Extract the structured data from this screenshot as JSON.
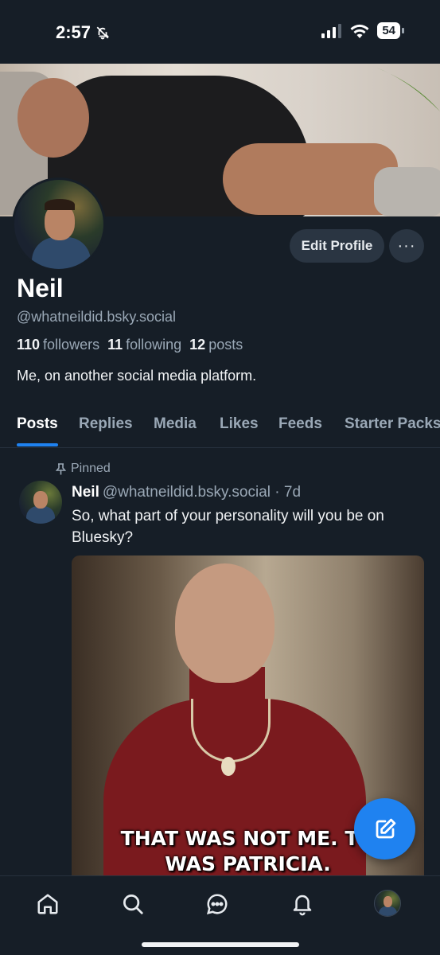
{
  "status_bar": {
    "time": "2:57",
    "battery": "54"
  },
  "profile": {
    "name": "Neil",
    "handle": "@whatneildid.bsky.social",
    "followers_count": "110",
    "followers_label": "followers",
    "following_count": "11",
    "following_label": "following",
    "posts_count": "12",
    "posts_label": "posts",
    "bio": "Me, on another social media platform.",
    "edit_profile_label": "Edit Profile",
    "more_label": "···"
  },
  "tabs": [
    {
      "label": "Posts",
      "active": true
    },
    {
      "label": "Replies",
      "active": false
    },
    {
      "label": "Media",
      "active": false
    },
    {
      "label": "Likes",
      "active": false
    },
    {
      "label": "Feeds",
      "active": false
    },
    {
      "label": "Starter Packs",
      "active": false
    }
  ],
  "pinned_post": {
    "pinned_label": "Pinned",
    "author_name": "Neil",
    "author_handle": "@whatneildid.bsky.social",
    "separator": "·",
    "age": "7d",
    "text": "So, what part of your personality will you be on Bluesky?",
    "gif_caption_line1": "THAT WAS NOT ME. TH",
    "gif_caption_line2": "WAS PATRICIA."
  },
  "bottom_nav": {
    "items": [
      "home-icon",
      "search-icon",
      "chat-icon",
      "bell-icon",
      "profile-avatar"
    ]
  },
  "colors": {
    "background": "#161e27",
    "accent": "#1f82f0",
    "muted_text": "#9aa8b6",
    "button_bg": "#2a3542"
  }
}
